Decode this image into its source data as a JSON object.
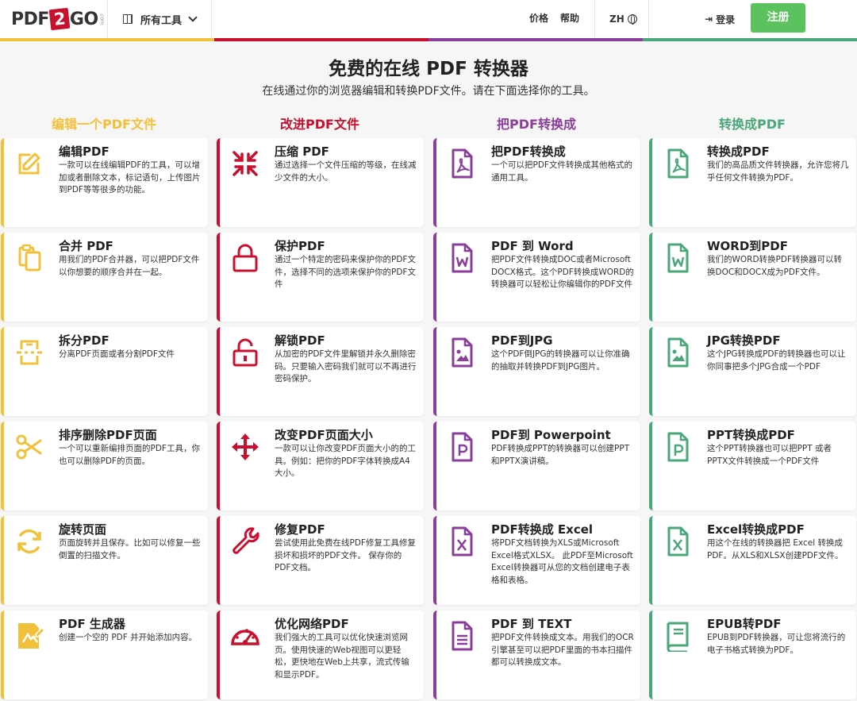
{
  "header": {
    "logo_pre": "PDF",
    "logo_two": "2",
    "logo_post": "GO",
    "logo_com": ".com",
    "all_tools": "所有工具",
    "pricing": "价格",
    "help": "帮助",
    "lang": "ZH",
    "login": "登录",
    "signup": "注册"
  },
  "colors": {
    "yellow": "#f2c13c",
    "red": "#c8102e",
    "purple": "#8a3d99",
    "green": "#4aa77a",
    "signup": "#5bc25e"
  },
  "hero": {
    "title": "免费的在线 PDF 转换器",
    "subtitle": "在线通过你的浏览器编辑和转换PDF文件。请在下面选择你的工具。"
  },
  "columns": [
    {
      "heading": "编辑一个PDF文件",
      "color": "#f2c13c",
      "tools": [
        {
          "icon": "edit-icon",
          "title": "编辑PDF",
          "desc": "一款可以在线编辑PDF的工具，可以增加或者删除文本，标记语句，上传图片到PDF等等很多的功能。"
        },
        {
          "icon": "merge-icon",
          "title": "合并 PDF",
          "desc": "用我们的PDF合并器，可以把PDF文件以你想要的顺序合并在一起。"
        },
        {
          "icon": "split-icon",
          "title": "拆分PDF",
          "desc": "分离PDF页面或者分割PDF文件"
        },
        {
          "icon": "scissors-icon",
          "title": "排序删除PDF页面",
          "desc": "一个可以重新编排页面的PDF工具，你也可以删除PDF的页面。"
        },
        {
          "icon": "rotate-icon",
          "title": "旋转页面",
          "desc": "页面旋转并且保存。比如可以修复一些倒置的扫描文件。"
        },
        {
          "icon": "pdf-creator-icon",
          "title": "PDF 生成器",
          "desc": "创建一个空的 PDF 并开始添加内容。"
        }
      ]
    },
    {
      "heading": "改进PDF文件",
      "color": "#c8102e",
      "tools": [
        {
          "icon": "compress-icon",
          "title": "压缩 PDF",
          "desc": "通过选择一个文件压缩的等级，在线减少文件的大小。"
        },
        {
          "icon": "lock-icon",
          "title": "保护PDF",
          "desc": "通过一个特定的密码来保护你的PDF文件，选择不同的选项来保护你的PDF文件"
        },
        {
          "icon": "unlock-icon",
          "title": "解锁PDF",
          "desc": "从加密的PDF文件里解锁并永久删除密码。只要输入密码我们就可以不再进行密码保护。"
        },
        {
          "icon": "move-icon",
          "title": "改变PDF页面大小",
          "desc": "一款可以让你改变PDF页面大小的的工具。例如：把你的PDF字体转换成A4大小。"
        },
        {
          "icon": "wrench-icon",
          "title": "修复PDF",
          "desc": "尝试使用此免费在线PDF修复工具修复损坏和损坏的PDF文件。 保存你的PDF文档。"
        },
        {
          "icon": "speedometer-icon",
          "title": "优化网络PDF",
          "desc": "我们强大的工具可以优化快速浏览网页。使用快速的Web视图可以更轻松，更快地在Web上共享，流式传输和显示PDF。"
        }
      ]
    },
    {
      "heading": "把PDF转换成",
      "color": "#8a3d99",
      "tools": [
        {
          "icon": "file-pdf-icon",
          "title": "把PDF转换成",
          "desc": "一个可以把PDF文件转换成其他格式的通用工具。"
        },
        {
          "icon": "file-word-icon",
          "title": "PDF 到 Word",
          "desc": "把PDF文件转换成DOC或者Microsoft DOCX格式。这个PDF转换成WORD的转换器可以轻松让你编辑你的PDF文件"
        },
        {
          "icon": "file-image-icon",
          "title": "PDF到JPG",
          "desc": "这个PDF倒JPG的转换器可以让你准确的抽取并转换PDF到JPG图片。"
        },
        {
          "icon": "file-powerpoint-icon",
          "title": "PDF到 Powerpoint",
          "desc": "PDF转换成PPT的转换器可以创建PPT和PPTX演讲稿。"
        },
        {
          "icon": "file-excel-icon",
          "title": "PDF转换成 Excel",
          "desc": "将PDF文档转换为XLS或Microsoft Excel格式XLSX。 此PDF至Microsoft Excel转换器可从您的文档创建电子表格和表格。"
        },
        {
          "icon": "file-text-icon",
          "title": "PDF 到 TEXT",
          "desc": "把PDF文件转换成文本。用我们的OCR引擎甚至可以把PDF里面的书本扫描件都可以转换成文本。"
        }
      ]
    },
    {
      "heading": "转换成PDF",
      "color": "#4aa77a",
      "tools": [
        {
          "icon": "file-pdf-icon",
          "title": "转换成PDF",
          "desc": "我们的高品质文件转换器，允许您将几乎任何文件转换为PDF。"
        },
        {
          "icon": "file-word-icon",
          "title": "WORD到PDF",
          "desc": "我们的WORD转换PDF转换器可以转换DOC和DOCX成为PDF文件。"
        },
        {
          "icon": "file-image-icon",
          "title": "JPG转换PDF",
          "desc": "这个JPG转换成PDF的转换器也可以让你同事把多个JPG合成一个PDF"
        },
        {
          "icon": "file-powerpoint-icon",
          "title": "PPT转换成PDF",
          "desc": "这个PPT转换器也可以把PPT 或者PPTX文件转换成一个PDF文件"
        },
        {
          "icon": "file-excel-icon",
          "title": "Excel转换成PDF",
          "desc": "用这个在线的转换器把 Excel 转换成 PDF。从XLS和XLSX创建PDF文件。"
        },
        {
          "icon": "book-icon",
          "title": "EPUB转PDF",
          "desc": "EPUB到PDF转换器，可让您将流行的电子书格式转换为PDF。"
        }
      ]
    }
  ]
}
